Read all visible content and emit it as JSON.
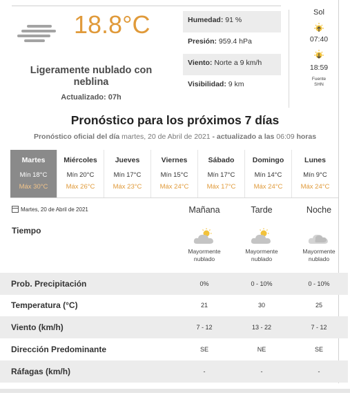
{
  "current": {
    "temperature": "18.8°C",
    "description": "Ligeramente nublado con neblina",
    "updated": "Actualizado: 07h",
    "icon": "fog-icon"
  },
  "stats": [
    {
      "label": "Humedad:",
      "value": " 91 %"
    },
    {
      "label": "Presión:",
      "value": " 959.4 hPa"
    },
    {
      "label": "Viento:",
      "value": " Norte a 9 km/h"
    },
    {
      "label": "Visibilidad:",
      "value": " 9 km"
    }
  ],
  "sun": {
    "title": "Sol",
    "sunrise": "07:40",
    "sunset": "18:59",
    "source_line1": "Fuente",
    "source_line2": "SHN"
  },
  "forecast": {
    "title": "Pronóstico para los próximos 7 días",
    "subtitle_prefix": "Pronóstico oficial del día",
    "subtitle_date": " martes, 20 de Abril de 2021 ",
    "subtitle_mid": "- actualizado a las",
    "subtitle_time": " 06:09 ",
    "subtitle_suffix": "horas"
  },
  "days": [
    {
      "name": "Martes",
      "min": "Mín 18°C",
      "max": "Máx 30°C",
      "active": true
    },
    {
      "name": "Miércoles",
      "min": "Mín 20°C",
      "max": "Máx 26°C"
    },
    {
      "name": "Jueves",
      "min": "Mín 17°C",
      "max": "Máx 23°C"
    },
    {
      "name": "Viernes",
      "min": "Mín 15°C",
      "max": "Máx 24°C"
    },
    {
      "name": "Sábado",
      "min": "Mín 17°C",
      "max": "Máx 17°C"
    },
    {
      "name": "Domingo",
      "min": "Mín 14°C",
      "max": "Máx 24°C"
    },
    {
      "name": "Lunes",
      "min": "Mín 9°C",
      "max": "Máx 24°C"
    }
  ],
  "detail": {
    "date": "Martes, 20 de Abril de 2021",
    "periods": [
      "Mañana",
      "Tarde",
      "Noche"
    ],
    "tiempo_label": "Tiempo",
    "weather": [
      {
        "label_line1": "Mayormente",
        "label_line2": "nublado",
        "icon": "partly-cloudy-day-icon"
      },
      {
        "label_line1": "Mayormente",
        "label_line2": "nublado",
        "icon": "partly-cloudy-day-icon"
      },
      {
        "label_line1": "Mayormente",
        "label_line2": "nublado",
        "icon": "partly-cloudy-night-icon"
      }
    ],
    "rows": [
      {
        "label": "Prob. Precipitación",
        "values": [
          "0%",
          "0 - 10%",
          "0 - 10%"
        ]
      },
      {
        "label": "Temperatura (°C)",
        "values": [
          "21",
          "30",
          "25"
        ]
      },
      {
        "label": "Viento (km/h)",
        "values": [
          "7 - 12",
          "13 - 22",
          "7 - 12"
        ]
      },
      {
        "label": "Dirección Predominante",
        "values": [
          "SE",
          "NE",
          "SE"
        ]
      },
      {
        "label": "Ráfagas (km/h)",
        "values": [
          "-",
          "-",
          "-"
        ]
      }
    ]
  },
  "colors": {
    "accent_temp": "#e09a3a",
    "active_day_bg": "#8a8a8a",
    "row_shade": "#ececec"
  }
}
